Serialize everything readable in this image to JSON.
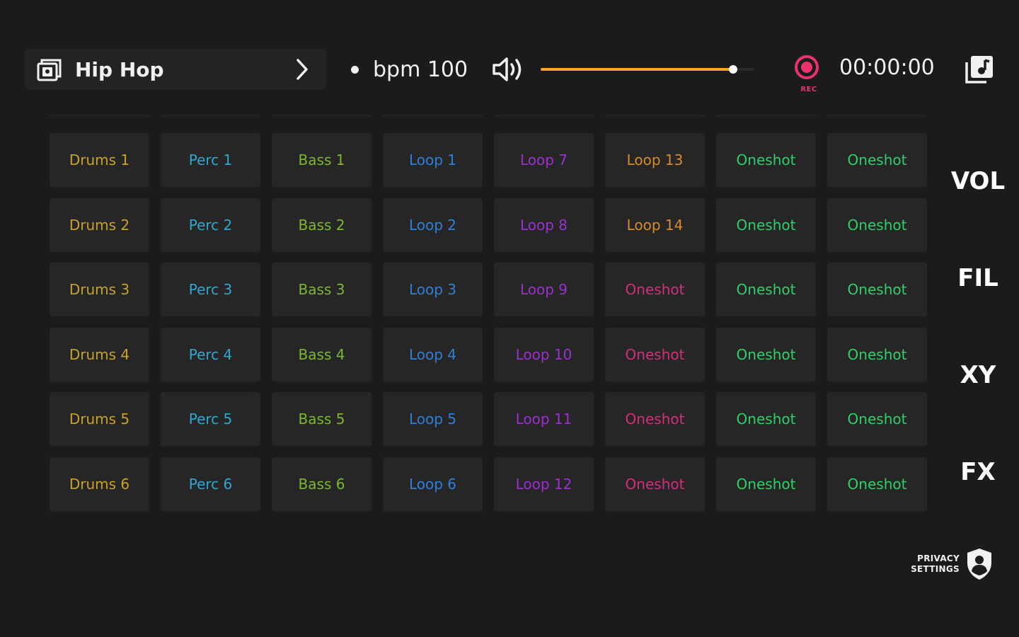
{
  "header": {
    "preset_name": "Hip Hop",
    "pack_icon": "sample-pack-icon",
    "chevron_icon": "chevron-right-icon",
    "bpm_label": "bpm 100",
    "volume_icon": "speaker-volume-icon",
    "volume_level_fraction": 0.9,
    "rec_label": "REC",
    "timer": "00:00:00",
    "export_icon": "music-library-icon"
  },
  "colors": {
    "background": "#1b1b1b",
    "pad": "#262626",
    "accent_orange": "#f5a623",
    "rec_pink": "#e8336d",
    "drums": "#c9a227",
    "perc": "#2fa7cf",
    "bass": "#7cb82f",
    "loop_blue": "#2f7fd8",
    "loop_purple": "#9b2fd1",
    "loop_orange": "#d88a2f",
    "oneshot_pink": "#d12f7a",
    "oneshot_green": "#2fcf6a"
  },
  "grid": {
    "rows": [
      [
        {
          "label": "Drums 1",
          "color": "#c9a227"
        },
        {
          "label": "Perc 1",
          "color": "#2fa7cf"
        },
        {
          "label": "Bass 1",
          "color": "#7cb82f"
        },
        {
          "label": "Loop 1",
          "color": "#2f7fd8"
        },
        {
          "label": "Loop 7",
          "color": "#9b2fd1"
        },
        {
          "label": "Loop 13",
          "color": "#d88a2f"
        },
        {
          "label": "Oneshot",
          "color": "#2fcf6a"
        },
        {
          "label": "Oneshot",
          "color": "#2fcf6a"
        }
      ],
      [
        {
          "label": "Drums 2",
          "color": "#c9a227"
        },
        {
          "label": "Perc 2",
          "color": "#2fa7cf"
        },
        {
          "label": "Bass 2",
          "color": "#7cb82f"
        },
        {
          "label": "Loop 2",
          "color": "#2f7fd8"
        },
        {
          "label": "Loop 8",
          "color": "#9b2fd1"
        },
        {
          "label": "Loop 14",
          "color": "#d88a2f"
        },
        {
          "label": "Oneshot",
          "color": "#2fcf6a"
        },
        {
          "label": "Oneshot",
          "color": "#2fcf6a"
        }
      ],
      [
        {
          "label": "Drums 3",
          "color": "#c9a227"
        },
        {
          "label": "Perc 3",
          "color": "#2fa7cf"
        },
        {
          "label": "Bass 3",
          "color": "#7cb82f"
        },
        {
          "label": "Loop 3",
          "color": "#2f7fd8"
        },
        {
          "label": "Loop 9",
          "color": "#9b2fd1"
        },
        {
          "label": "Oneshot",
          "color": "#d12f7a"
        },
        {
          "label": "Oneshot",
          "color": "#2fcf6a"
        },
        {
          "label": "Oneshot",
          "color": "#2fcf6a"
        }
      ],
      [
        {
          "label": "Drums 4",
          "color": "#c9a227"
        },
        {
          "label": "Perc 4",
          "color": "#2fa7cf"
        },
        {
          "label": "Bass 4",
          "color": "#7cb82f"
        },
        {
          "label": "Loop 4",
          "color": "#2f7fd8"
        },
        {
          "label": "Loop 10",
          "color": "#9b2fd1"
        },
        {
          "label": "Oneshot",
          "color": "#d12f7a"
        },
        {
          "label": "Oneshot",
          "color": "#2fcf6a"
        },
        {
          "label": "Oneshot",
          "color": "#2fcf6a"
        }
      ],
      [
        {
          "label": "Drums 5",
          "color": "#c9a227"
        },
        {
          "label": "Perc 5",
          "color": "#2fa7cf"
        },
        {
          "label": "Bass 5",
          "color": "#7cb82f"
        },
        {
          "label": "Loop 5",
          "color": "#2f7fd8"
        },
        {
          "label": "Loop 11",
          "color": "#9b2fd1"
        },
        {
          "label": "Oneshot",
          "color": "#d12f7a"
        },
        {
          "label": "Oneshot",
          "color": "#2fcf6a"
        },
        {
          "label": "Oneshot",
          "color": "#2fcf6a"
        }
      ],
      [
        {
          "label": "Drums 6",
          "color": "#c9a227"
        },
        {
          "label": "Perc 6",
          "color": "#2fa7cf"
        },
        {
          "label": "Bass 6",
          "color": "#7cb82f"
        },
        {
          "label": "Loop 6",
          "color": "#2f7fd8"
        },
        {
          "label": "Loop 12",
          "color": "#9b2fd1"
        },
        {
          "label": "Oneshot",
          "color": "#d12f7a"
        },
        {
          "label": "Oneshot",
          "color": "#2fcf6a"
        },
        {
          "label": "Oneshot",
          "color": "#2fcf6a"
        }
      ]
    ]
  },
  "side_tabs": [
    "VOL",
    "FIL",
    "XY",
    "FX"
  ],
  "privacy": {
    "line1": "PRIVACY",
    "line2": "SETTINGS",
    "icon": "privacy-shield-icon"
  }
}
